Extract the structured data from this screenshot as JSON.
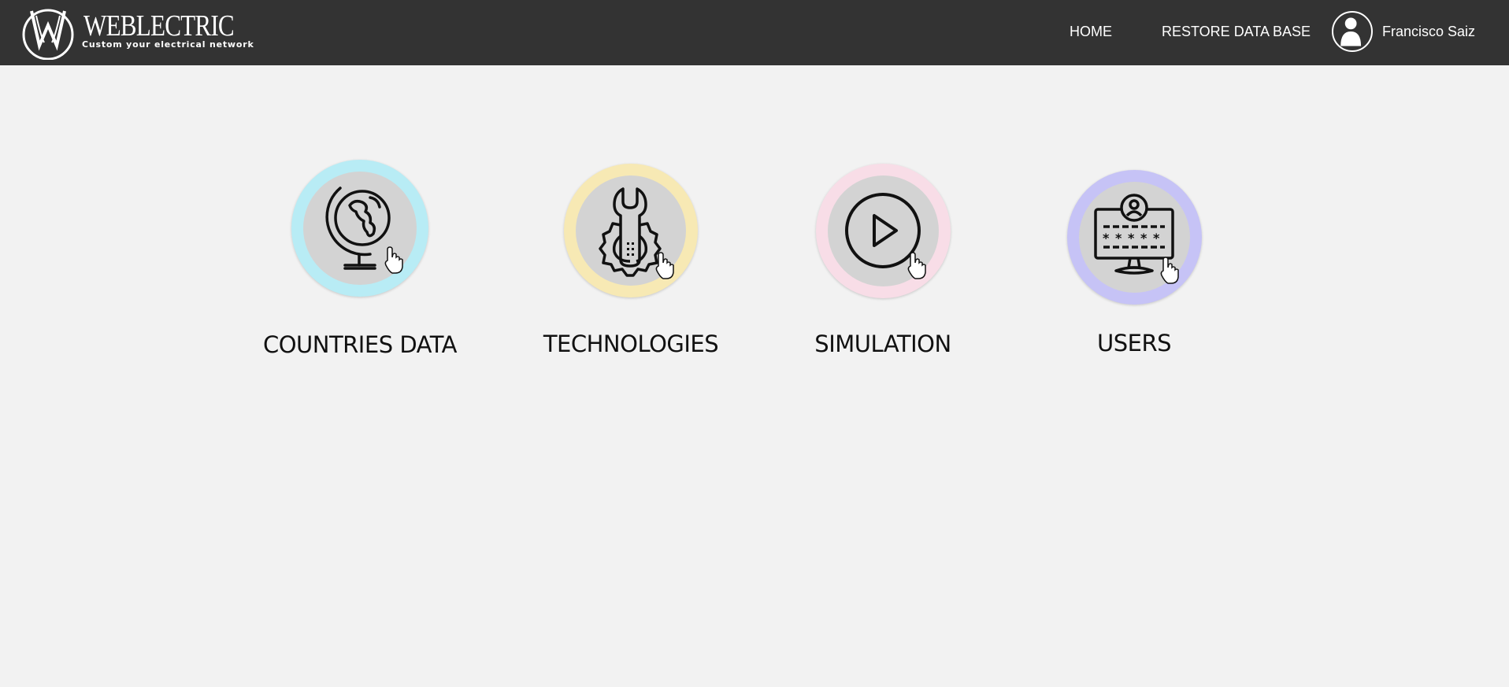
{
  "header": {
    "brand_name": "WEBLECTRIC",
    "brand_tagline": "Custom your electrical network",
    "nav": {
      "home_label": "HOME",
      "restore_label": "RESTORE DATA BASE"
    },
    "user": {
      "name": "Francisco Saiz",
      "avatar_icon": "user-silhouette-icon"
    }
  },
  "tiles": [
    {
      "label": "COUNTRIES DATA",
      "icon": "globe-icon",
      "ring_color": "#b8ecf5"
    },
    {
      "label": "TECHNOLOGIES",
      "icon": "wrench-gear-icon",
      "ring_color": "#f7e9b4"
    },
    {
      "label": "SIMULATION",
      "icon": "play-icon",
      "ring_color": "#f8dde7"
    },
    {
      "label": "USERS",
      "icon": "monitor-password-icon",
      "ring_color": "#c6c3f6"
    }
  ],
  "colors": {
    "header_bg": "#333333",
    "page_bg": "#f2f2f2",
    "tile_inner": "#d3d3d3"
  }
}
